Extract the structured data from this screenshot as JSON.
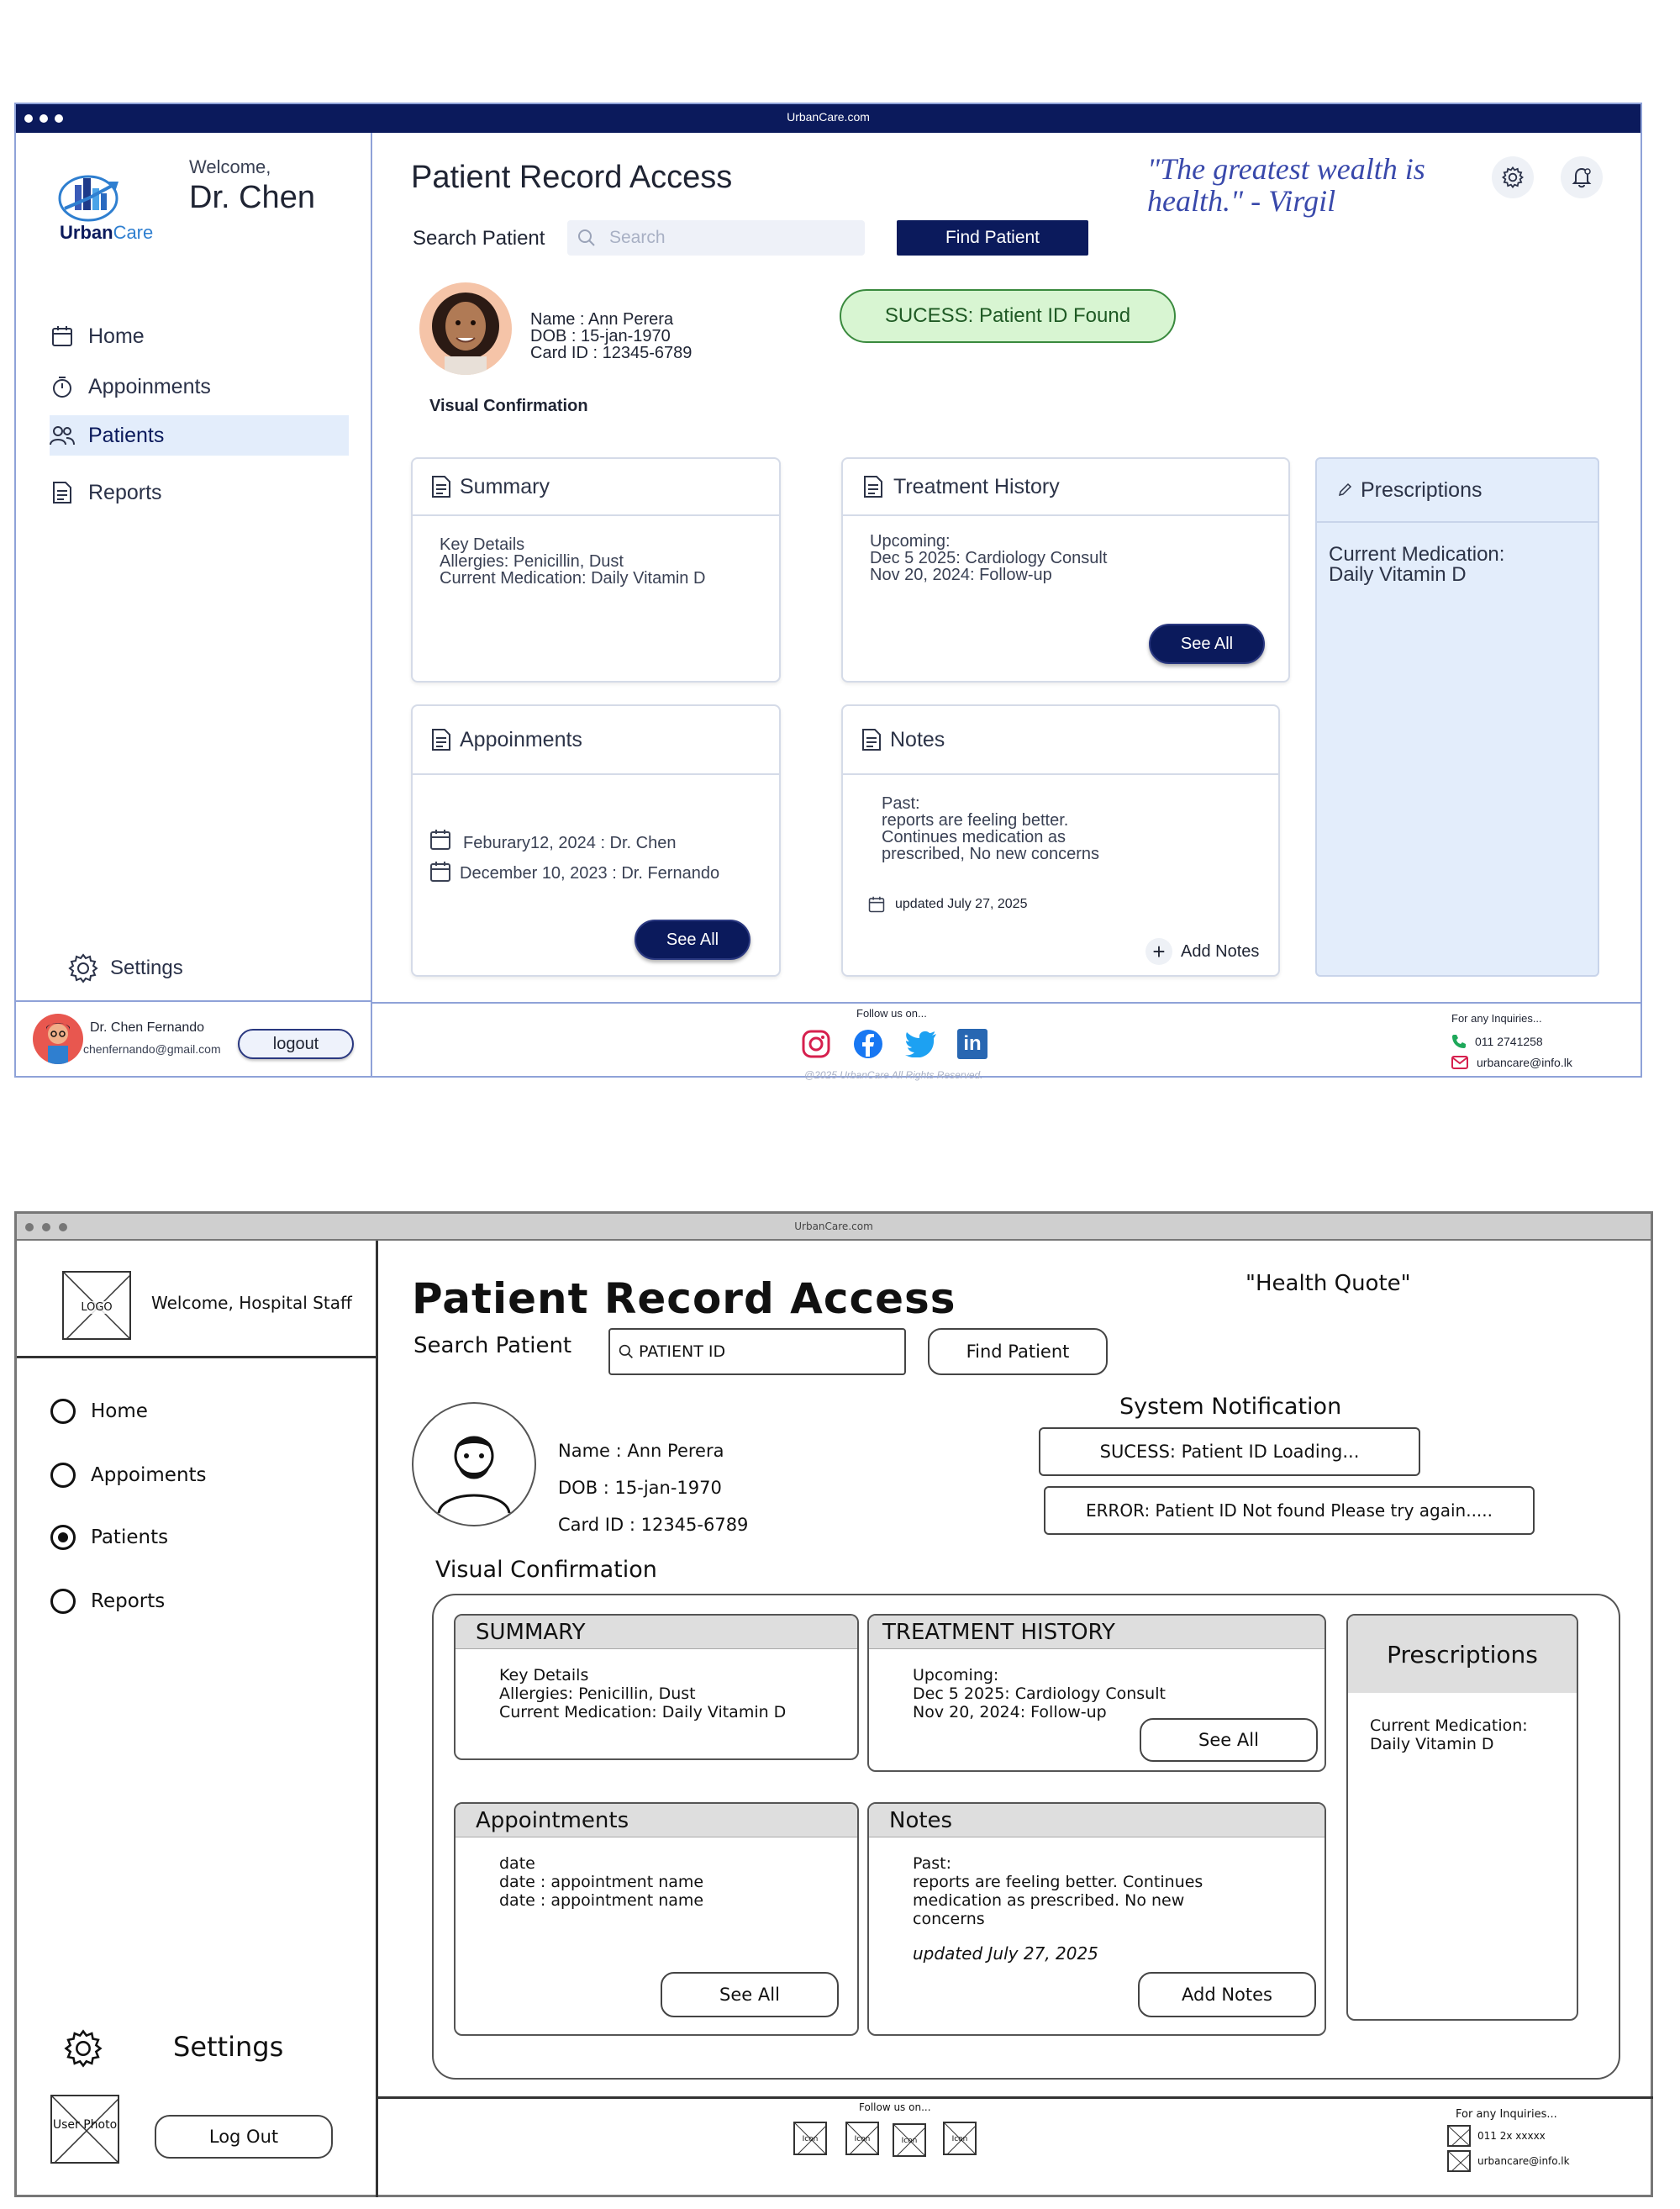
{
  "hifi": {
    "url": "UrbanCare.com",
    "brand": {
      "urban": "Urban",
      "care": "Care"
    },
    "welcome": "Welcome,",
    "user_name": "Dr. Chen",
    "nav": [
      {
        "label": "Home",
        "icon": "calendar-icon"
      },
      {
        "label": "Appoinments",
        "icon": "timer-icon"
      },
      {
        "label": "Patients",
        "icon": "users-icon"
      },
      {
        "label": "Reports",
        "icon": "document-icon"
      }
    ],
    "settings": "Settings",
    "footer_user": {
      "name": "Dr. Chen Fernando",
      "email": "chenfernando@gmail.com",
      "logout": "logout"
    },
    "page_title": "Patient Record Access",
    "search_label": "Search Patient",
    "search_placeholder": "Search",
    "find_button": "Find Patient",
    "quote": "\"The greatest wealth is health.\" - Virgil",
    "patient": {
      "name": "Name : Ann Perera",
      "dob": "DOB : 15-jan-1970",
      "card": "Card ID : 12345-6789"
    },
    "visual_confirmation": "Visual Confirmation",
    "notification": "SUCESS: Patient ID Found",
    "summary": {
      "title": "Summary",
      "lines": [
        "Key Details",
        "Allergies: Penicillin, Dust",
        "Current Medication: Daily Vitamin D"
      ]
    },
    "treatment": {
      "title": "Treatment History",
      "lines": [
        "Upcoming:",
        "Dec 5 2025: Cardiology Consult",
        "Nov 20, 2024: Follow-up"
      ],
      "button": "See All"
    },
    "prescriptions": {
      "title": "Prescriptions",
      "lines": [
        "Current Medication:",
        "Daily Vitamin D"
      ]
    },
    "appointments": {
      "title": "Appoinments",
      "items": [
        "Feburary12, 2024 : Dr. Chen",
        "December 10, 2023 : Dr. Fernando"
      ],
      "button": "See All"
    },
    "notes": {
      "title": "Notes",
      "lines": [
        "Past:",
        "reports are feeling better.",
        "Continues medication as",
        "prescribed, No new concerns"
      ],
      "updated": "updated July 27, 2025",
      "add": "Add Notes"
    },
    "footer": {
      "follow": "Follow us on...",
      "copyright": "@2025 UrbanCare All Rights Reserved.",
      "inquiries": "For any Inquiries...",
      "phone": "011 2741258",
      "email": "urbancare@info.lk"
    }
  },
  "wireframe": {
    "url": "UrbanCare.com",
    "logo": "LOGO",
    "welcome": "Welcome, Hospital Staff",
    "nav": [
      "Home",
      "Appoiments",
      "Patients",
      "Reports"
    ],
    "settings": "Settings",
    "user_photo": "User Photo",
    "logout": "Log Out",
    "page_title": "Patient Record Access",
    "quote": "\"Health Quote\"",
    "search_label": "Search Patient",
    "search_value": "PATIENT ID",
    "find_button": "Find Patient",
    "notification_title": "System Notification",
    "notif_loading": "SUCESS: Patient ID Loading...",
    "notif_error": "ERROR: Patient ID Not found Please try again.....",
    "patient": {
      "name": "Name : Ann Perera",
      "dob": "DOB : 15-jan-1970",
      "card": "Card ID : 12345-6789"
    },
    "visual_confirmation": "Visual Confirmation",
    "summary": {
      "title": "SUMMARY",
      "lines": [
        "Key Details",
        "Allergies: Penicillin, Dust",
        "Current Medication: Daily Vitamin D"
      ]
    },
    "treatment": {
      "title": "TREATMENT HISTORY",
      "lines": [
        "Upcoming:",
        "Dec 5 2025: Cardiology Consult",
        "Nov 20, 2024: Follow-up"
      ],
      "button": "See All"
    },
    "prescriptions": {
      "title": "Prescriptions",
      "lines": [
        "Current Medication:",
        "Daily Vitamin D"
      ]
    },
    "appointments": {
      "title": "Appointments",
      "lines": [
        "date",
        "date : appointment name",
        "date : appointment name"
      ],
      "button": "See All"
    },
    "notes": {
      "title": "Notes",
      "lines": [
        "Past:",
        "reports are feeling better. Continues",
        "medication as prescribed. No new",
        "concerns"
      ],
      "updated": "updated July 27, 2025",
      "button": "Add Notes"
    },
    "footer": {
      "follow": "Follow us on...",
      "icon": "Icon",
      "inquiries": "For any Inquiries...",
      "phone": "011 2x xxxxx",
      "email": "urbancare@info.lk"
    }
  }
}
